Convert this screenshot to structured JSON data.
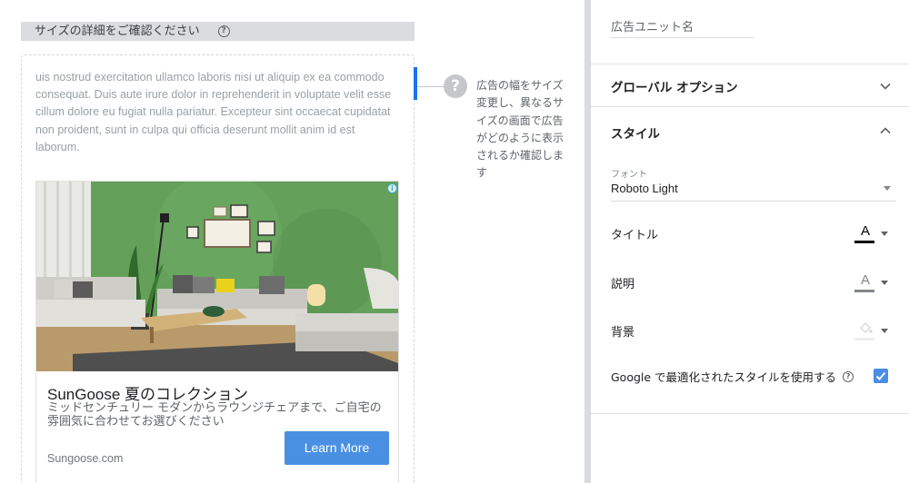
{
  "preview": {
    "size_header": "サイズの詳細をご確認ください",
    "size_help": "?",
    "lorem": "uis nostrud exercitation ullamco laboris nisi ut aliquip ex ea commodo consequat. Duis aute irure dolor in reprehenderit in voluptate velit esse cillum dolore eu fugiat nulla pariatur. Excepteur sint occaecat cupidatat non proident, sunt in culpa qui officia deserunt mollit anim id est laborum.",
    "hint_icon": "?",
    "hint": "広告の幅をサイズ変更し、異なるサイズの画面で広告がどのように表示されるか確認します"
  },
  "ad": {
    "image_icon": "living-room-photo",
    "info_icon": "i",
    "title": "SunGoose 夏のコレクション",
    "description": "ミッドセンチュリー モダンからラウンジチェアまで、ご自宅の雰囲気に合わせてお選びください",
    "url": "Sungoose.com",
    "cta": "Learn More",
    "cta_color": "#4a90e2"
  },
  "settings": {
    "ad_unit_name_placeholder": "広告ユニット名",
    "global_options": {
      "title": "グローバル オプション",
      "expanded": false
    },
    "style": {
      "title": "スタイル",
      "expanded": true,
      "font_label": "フォント",
      "font_value": "Roboto Light",
      "title_row": {
        "label": "タイトル",
        "glyph": "A",
        "swatch_color": "#000000"
      },
      "description_row": {
        "label": "説明",
        "glyph": "A",
        "swatch_color": "#80868b"
      },
      "background_row": {
        "label": "背景",
        "icon": "paint-bucket-icon",
        "swatch_color": "#eeeeee"
      },
      "google_optimized": {
        "label": "Google で最適化されたスタイルを使用する",
        "help": "?",
        "checked": true
      }
    }
  },
  "colors": {
    "accent": "#1a73e8",
    "checkbox": "#4a8ee6",
    "divider": "#d9dbde"
  }
}
